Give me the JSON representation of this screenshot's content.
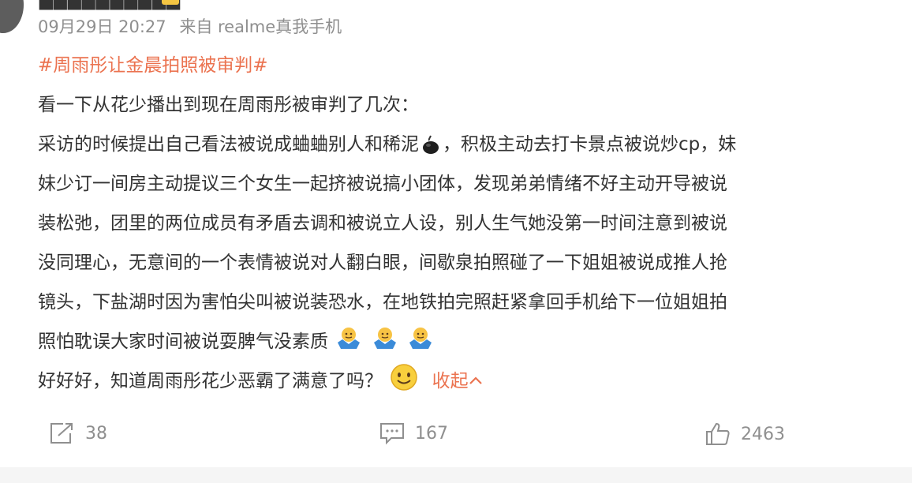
{
  "post": {
    "timestamp": "09月29日 20:27",
    "source": "来自 realme真我手机",
    "hashtag": "#周雨彤让金晨拍照被审判#",
    "lines": [
      "看一下从花少播出到现在周雨彤被审判了几次：",
      "采访的时候提出自己看法被说成蛐蛐别人和稀泥",
      "，积极主动去打卡景点被说炒cp，妹",
      "妹少订一间房主动提议三个女生一起挤被说搞小团体，发现弟弟情绪不好主动开导被说",
      "装松弛，团里的两位成员有矛盾去调和被说立人设，别人生气她没第一时间注意到被说",
      "没同理心，无意间的一个表情被说对人翻白眼，间歇泉拍照碰了一下姐姐被说成推人抢",
      "镜头，下盐湖时因为害怕尖叫被说装恐水，在地铁拍完照赶紧拿回手机给下一位姐姐拍",
      "照怕耽误大家时间被说耍脾气没素质",
      "好好好，知道周雨彤花少恶霸了满意了吗？"
    ],
    "collapse_label": "收起"
  },
  "actions": {
    "repost_count": "38",
    "comment_count": "167",
    "like_count": "2463"
  },
  "icons": {
    "mud": "mud-emoji-icon",
    "shrug": "shrug-emoji-icon",
    "smile": "smile-emoji-icon",
    "repost": "repost-icon",
    "comment": "comment-icon",
    "like": "thumbs-up-icon",
    "chevron": "chevron-up-icon"
  },
  "colors": {
    "accent": "#eb7350",
    "meta_gray": "#8f8f8f",
    "text": "#333333"
  }
}
